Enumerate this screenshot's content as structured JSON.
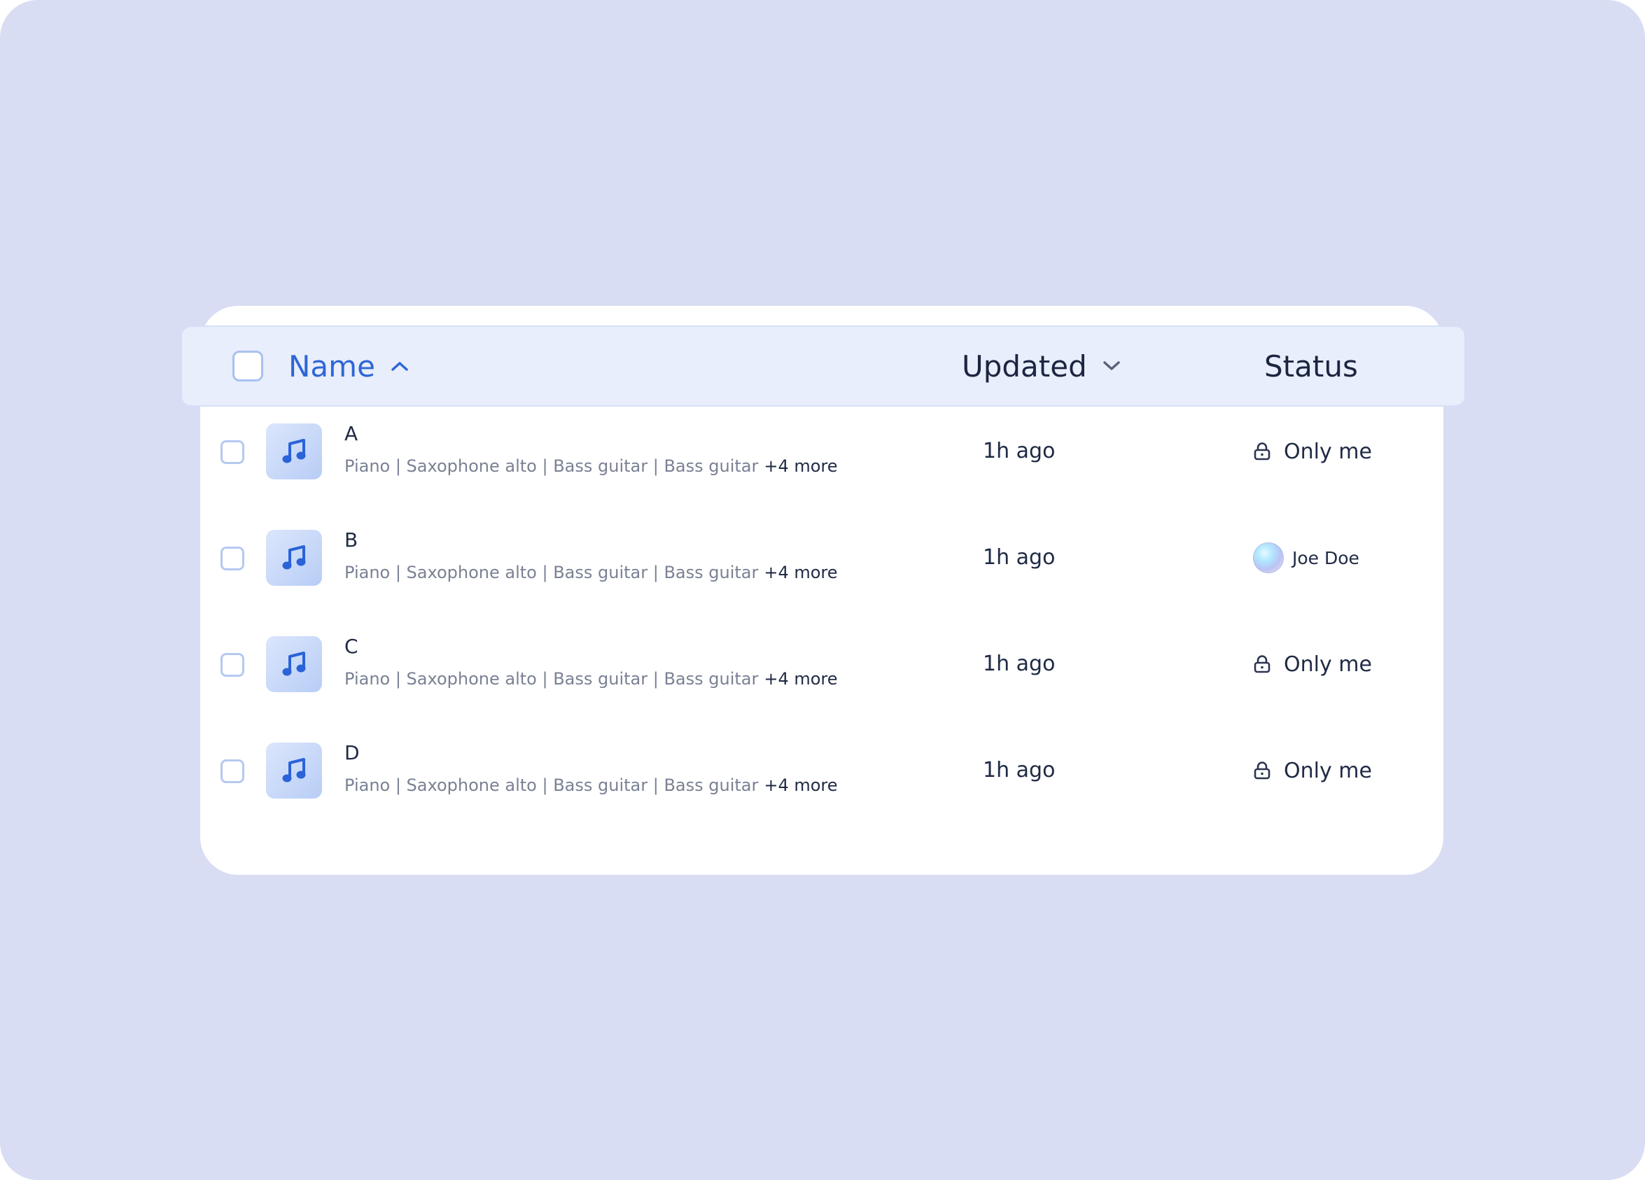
{
  "header": {
    "name_label": "Name",
    "updated_label": "Updated",
    "status_label": "Status",
    "name_sort": "ascending",
    "updated_sort": "descending"
  },
  "rows": [
    {
      "name": "A",
      "tags": "Piano | Saxophone alto | Bass guitar | Bass guitar",
      "more": "+4 more",
      "updated": "1h ago",
      "status": "Only me",
      "status_icon": "lock-icon"
    },
    {
      "name": "B",
      "tags": "Piano | Saxophone alto | Bass guitar | Bass guitar",
      "more": "+4 more",
      "updated": "1h ago",
      "status": "Joe Doe",
      "status_icon": "avatar"
    },
    {
      "name": "C",
      "tags": "Piano | Saxophone alto | Bass guitar | Bass guitar",
      "more": "+4 more",
      "updated": "1h ago",
      "status": "Only me",
      "status_icon": "lock-icon"
    },
    {
      "name": "D",
      "tags": "Piano | Saxophone alto | Bass guitar | Bass guitar",
      "more": "+4 more",
      "updated": "1h ago",
      "status": "Only me",
      "status_icon": "lock-icon"
    }
  ],
  "icons": {
    "file": "music-note-icon",
    "sort_asc": "chevron-up-icon",
    "sort_desc": "chevron-down-icon"
  },
  "colors": {
    "accent": "#2f66d6",
    "background": "#d8ddf3",
    "header_bg": "#e8eefb",
    "card_bg": "#ffffff",
    "text_primary": "#1f2a44",
    "text_secondary": "#7a8194"
  }
}
